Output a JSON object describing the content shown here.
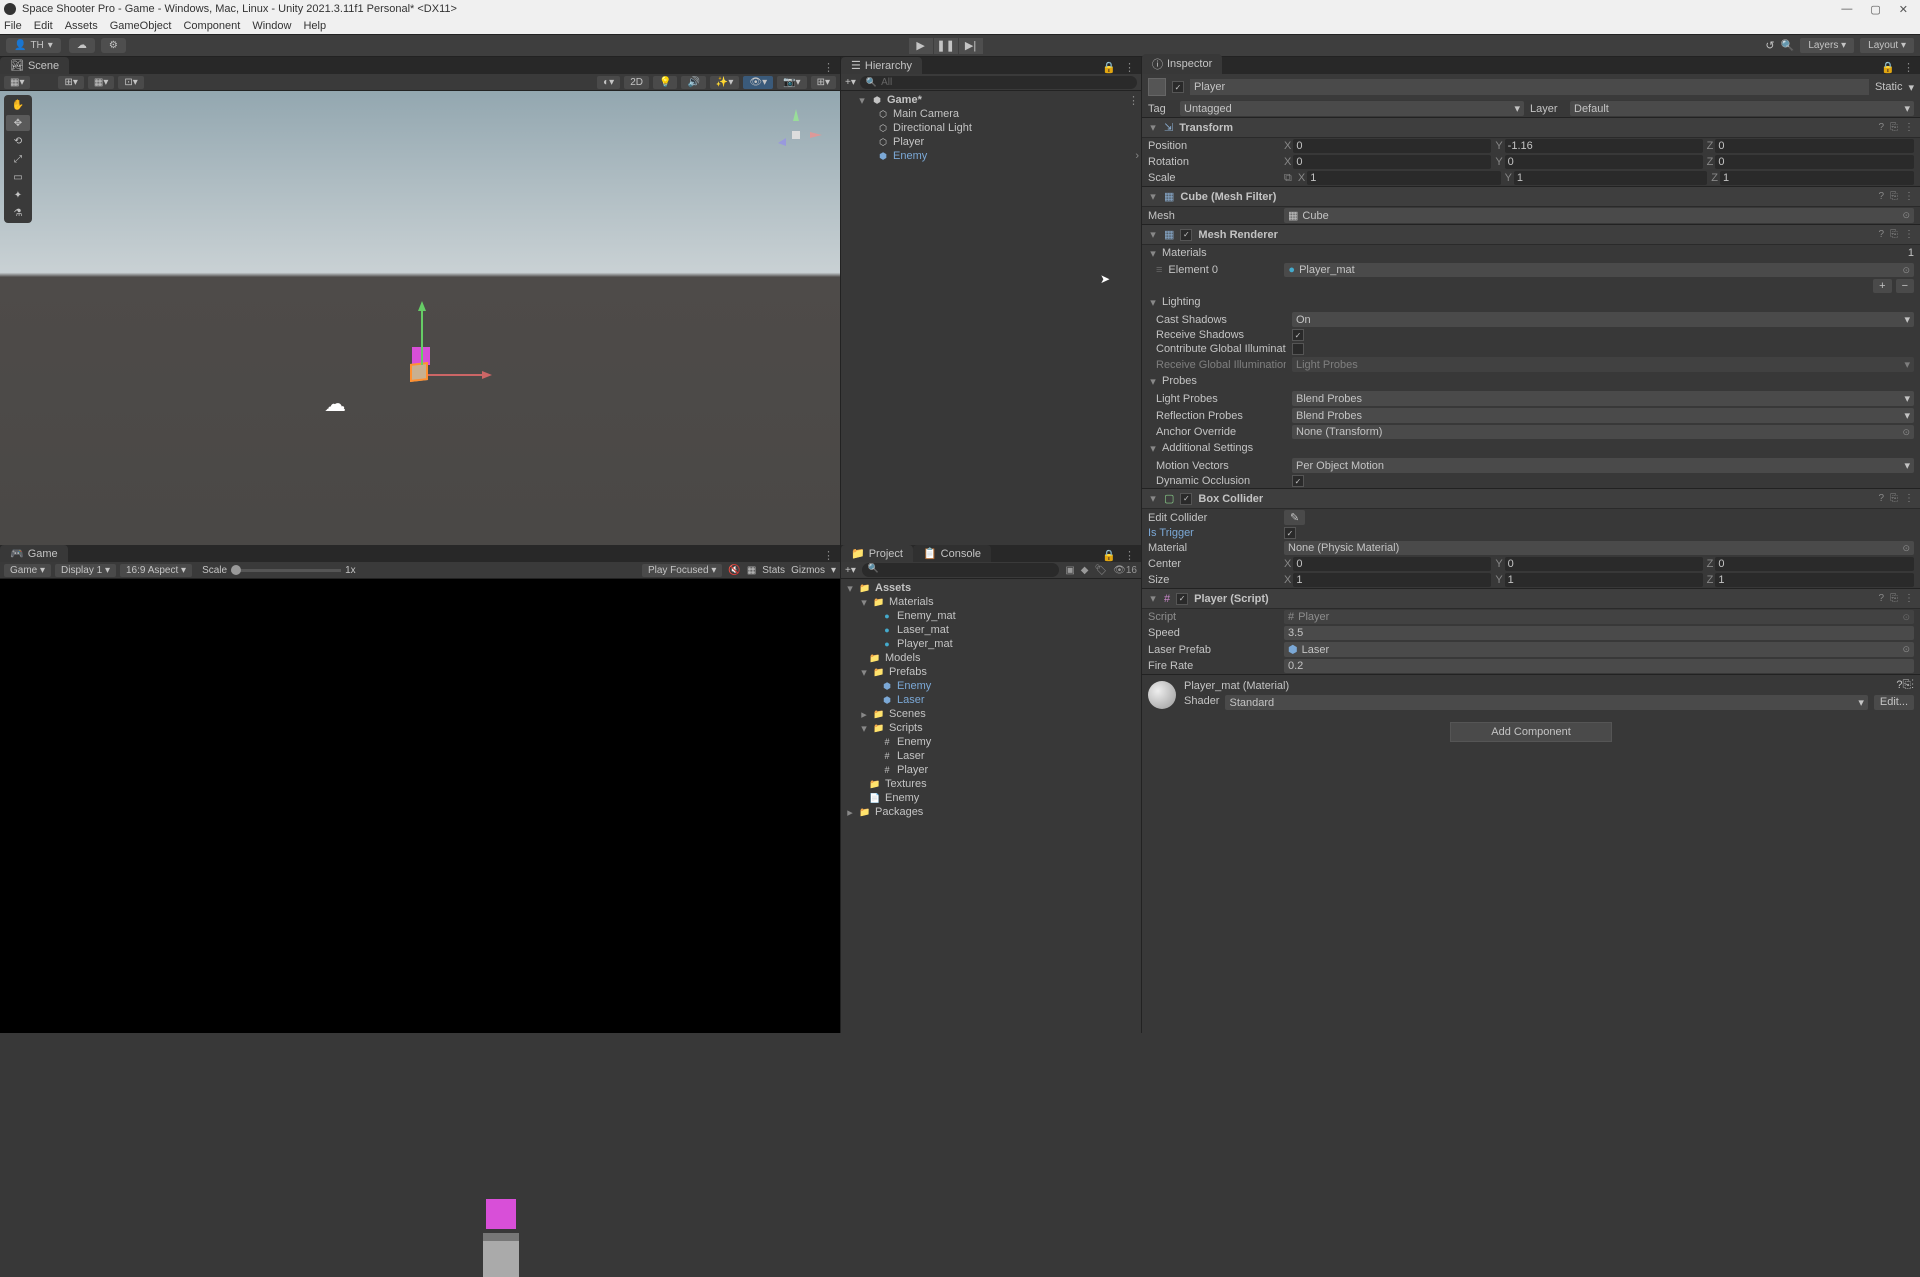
{
  "titlebar": {
    "title": "Space Shooter Pro - Game - Windows, Mac, Linux - Unity 2021.3.11f1 Personal* <DX11>"
  },
  "menubar": [
    "File",
    "Edit",
    "Assets",
    "GameObject",
    "Component",
    "Window",
    "Help"
  ],
  "toolbar": {
    "account": "TH",
    "layers": "Layers",
    "layout": "Layout"
  },
  "scene": {
    "tab": "Scene",
    "mode2d": "2D"
  },
  "game": {
    "tab": "Game",
    "dropdown": "Game",
    "display": "Display 1",
    "aspect": "16:9 Aspect",
    "scale_label": "Scale",
    "scale_value": "1x",
    "play_focused": "Play Focused",
    "stats": "Stats",
    "gizmos": "Gizmos"
  },
  "hierarchy": {
    "tab": "Hierarchy",
    "search_label": "All",
    "scene_name": "Game*",
    "items": [
      "Main Camera",
      "Directional Light",
      "Player",
      "Enemy"
    ]
  },
  "project": {
    "tab": "Project",
    "console_tab": "Console",
    "hidden_count": "16",
    "root": "Assets",
    "materials": {
      "name": "Materials",
      "items": [
        "Enemy_mat",
        "Laser_mat",
        "Player_mat"
      ]
    },
    "models": "Models",
    "prefabs": {
      "name": "Prefabs",
      "items": [
        "Enemy",
        "Laser"
      ]
    },
    "scenes": "Scenes",
    "scripts": {
      "name": "Scripts",
      "items": [
        "Enemy",
        "Laser",
        "Player"
      ]
    },
    "textures": "Textures",
    "enemy": "Enemy",
    "packages": "Packages"
  },
  "inspector": {
    "tab": "Inspector",
    "name": "Player",
    "static": "Static",
    "tag_label": "Tag",
    "tag": "Untagged",
    "layer_label": "Layer",
    "layer": "Default",
    "transform": {
      "title": "Transform",
      "position": "Position",
      "rotation": "Rotation",
      "scale": "Scale",
      "pos": {
        "x": "0",
        "y": "-1.16",
        "z": "0"
      },
      "rot": {
        "x": "0",
        "y": "0",
        "z": "0"
      },
      "scl": {
        "x": "1",
        "y": "1",
        "z": "1"
      }
    },
    "meshfilter": {
      "title": "Cube (Mesh Filter)",
      "mesh_label": "Mesh",
      "mesh": "Cube"
    },
    "meshrenderer": {
      "title": "Mesh Renderer",
      "materials": "Materials",
      "mat_count": "1",
      "element0_label": "Element 0",
      "element0": "Player_mat",
      "lighting": "Lighting",
      "cast_shadows_label": "Cast Shadows",
      "cast_shadows": "On",
      "receive_shadows": "Receive Shadows",
      "contribute_gi": "Contribute Global Illumination",
      "receive_gi_label": "Receive Global Illumination",
      "receive_gi": "Light Probes",
      "probes": "Probes",
      "light_probes_label": "Light Probes",
      "light_probes": "Blend Probes",
      "reflection_probes_label": "Reflection Probes",
      "reflection_probes": "Blend Probes",
      "anchor_label": "Anchor Override",
      "anchor": "None (Transform)",
      "additional": "Additional Settings",
      "motion_label": "Motion Vectors",
      "motion": "Per Object Motion",
      "dynamic_occlusion": "Dynamic Occlusion"
    },
    "boxcollider": {
      "title": "Box Collider",
      "edit_collider": "Edit Collider",
      "is_trigger": "Is Trigger",
      "material_label": "Material",
      "material": "None (Physic Material)",
      "center": "Center",
      "size": "Size",
      "cen": {
        "x": "0",
        "y": "0",
        "z": "0"
      },
      "siz": {
        "x": "1",
        "y": "1",
        "z": "1"
      }
    },
    "script": {
      "title": "Player (Script)",
      "script_label": "Script",
      "script": "Player",
      "speed_label": "Speed",
      "speed": "3.5",
      "laser_label": "Laser Prefab",
      "laser": "Laser",
      "firerate_label": "Fire Rate",
      "firerate": "0.2"
    },
    "material": {
      "title": "Player_mat (Material)",
      "shader_label": "Shader",
      "shader": "Standard",
      "edit": "Edit..."
    },
    "add_component": "Add Component"
  }
}
